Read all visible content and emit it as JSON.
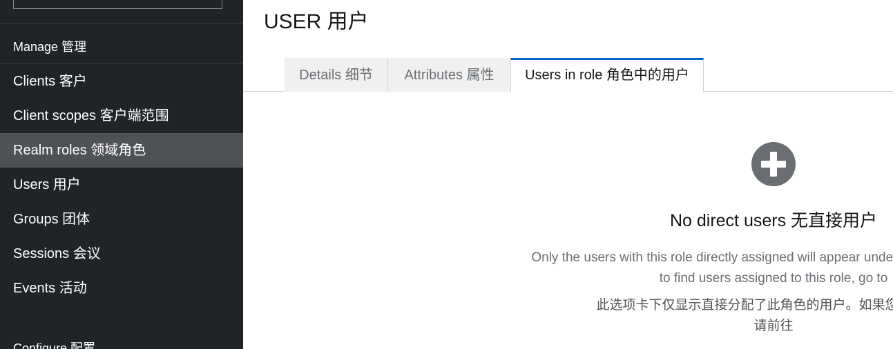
{
  "sidebar": {
    "manage_title": "Manage  管理",
    "configure_title": "Configure  配置",
    "items": [
      {
        "label": "Clients  客户",
        "active": false
      },
      {
        "label": "Client scopes  客户端范围",
        "active": false
      },
      {
        "label": "Realm roles  领域角色",
        "active": true
      },
      {
        "label": "Users  用户",
        "active": false
      },
      {
        "label": "Groups  团体",
        "active": false
      },
      {
        "label": "Sessions  会议",
        "active": false
      },
      {
        "label": "Events  活动",
        "active": false
      }
    ]
  },
  "header": {
    "title": "USER  用户"
  },
  "tabs": [
    {
      "label": "Details  细节",
      "active": false
    },
    {
      "label": "Attributes  属性",
      "active": false
    },
    {
      "label": "Users in role  角色中的用户",
      "active": true
    }
  ],
  "empty_state": {
    "icon": "plus-circle-icon",
    "title": "No direct users  无直接用户",
    "body_en_line1": "Only the users with this role directly assigned will appear under this tab. If you need",
    "body_en_line2": "to find users assigned to this role, go to",
    "body_zh_line1": "此选项卡下仅显示直接分配了此角色的用户。如果您需要查找",
    "body_zh_line2": "请前往"
  },
  "colors": {
    "sidebar_bg": "#212427",
    "sidebar_active_bg": "#4f5255",
    "tab_active_border": "#0066cc",
    "icon_color": "#6a6e73"
  }
}
